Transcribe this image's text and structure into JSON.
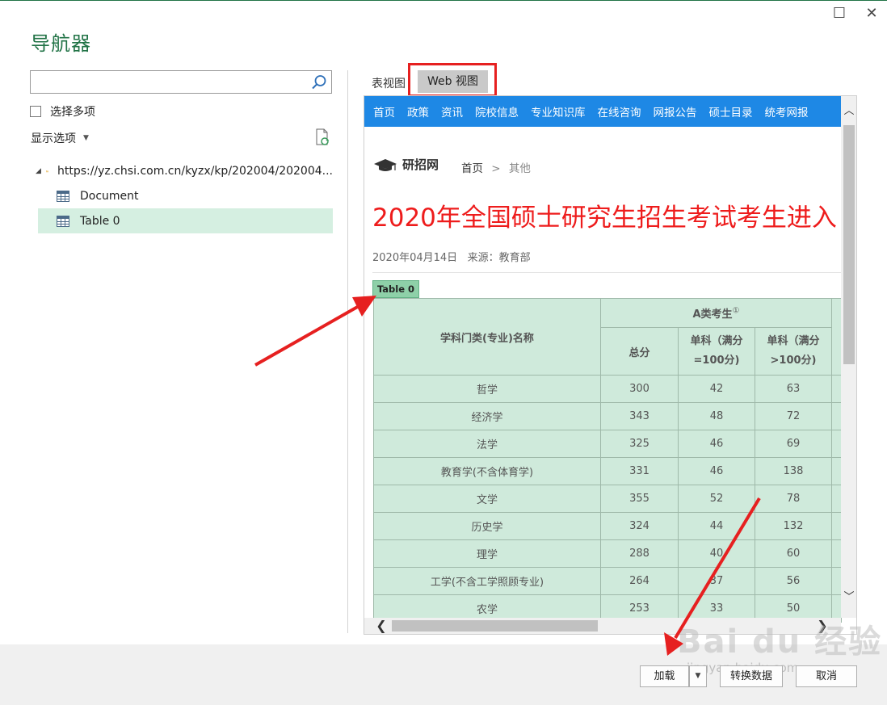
{
  "window": {
    "title": "导航器",
    "maximize_glyph": "☐",
    "close_glyph": "✕"
  },
  "left_panel": {
    "search": {
      "value": "",
      "placeholder": ""
    },
    "select_multiple_label": "选择多项",
    "display_options_label": "显示选项",
    "tree": {
      "root_label": "https://yz.chsi.com.cn/kyzx/kp/202004/202004...",
      "children": [
        {
          "label": "Document",
          "selected": false
        },
        {
          "label": "Table 0",
          "selected": true
        }
      ]
    }
  },
  "tabs": {
    "table_view_label": "表视图",
    "web_view_label": "Web 视图",
    "active": "Web 视图"
  },
  "webpage": {
    "nav_items": [
      "首页",
      "政策",
      "资讯",
      "院校信息",
      "专业知识库",
      "在线咨询",
      "网报公告",
      "硕士目录",
      "统考网报"
    ],
    "logo_text": "研招网",
    "breadcrumb": {
      "home": "首页",
      "separator": ">",
      "current": "其他"
    },
    "headline": "2020年全国硕士研究生招生考试考生进入",
    "meta": "2020年04月14日   来源：教育部",
    "table_tag": "Table 0",
    "table": {
      "header_subject": "学科门类(专业)名称",
      "header_group": "A类考生",
      "header_group_sup": "①",
      "header_total": "总分",
      "header_single1_line1": "单科（满分",
      "header_single1_line2": "=100分)",
      "header_single2_line1": "单科（满分",
      "header_single2_line2": ">100分)",
      "rows": [
        {
          "name": "哲学",
          "total": "300",
          "s100": "42",
          "s_over": "63"
        },
        {
          "name": "经济学",
          "total": "343",
          "s100": "48",
          "s_over": "72"
        },
        {
          "name": "法学",
          "total": "325",
          "s100": "46",
          "s_over": "69"
        },
        {
          "name": "教育学(不含体育学)",
          "total": "331",
          "s100": "46",
          "s_over": "138"
        },
        {
          "name": "文学",
          "total": "355",
          "s100": "52",
          "s_over": "78"
        },
        {
          "name": "历史学",
          "total": "324",
          "s100": "44",
          "s_over": "132"
        },
        {
          "name": "理学",
          "total": "288",
          "s100": "40",
          "s_over": "60"
        },
        {
          "name": "工学(不含工学照顾专业)",
          "total": "264",
          "s100": "37",
          "s_over": "56"
        },
        {
          "name": "农学",
          "total": "253",
          "s100": "33",
          "s_over": "50"
        }
      ]
    }
  },
  "footer": {
    "load_label": "加载",
    "transform_label": "转换数据",
    "cancel_label": "取消"
  },
  "watermark": {
    "text": "Bai du 经验",
    "sub": "jingyan.baidu.com"
  },
  "colors": {
    "accent": "#217346",
    "nav_bar": "#1e88e5",
    "headline": "#ee1c1c",
    "table_cell": "#cfeadb",
    "selection": "#d5efe1",
    "annotation": "#e62020"
  }
}
